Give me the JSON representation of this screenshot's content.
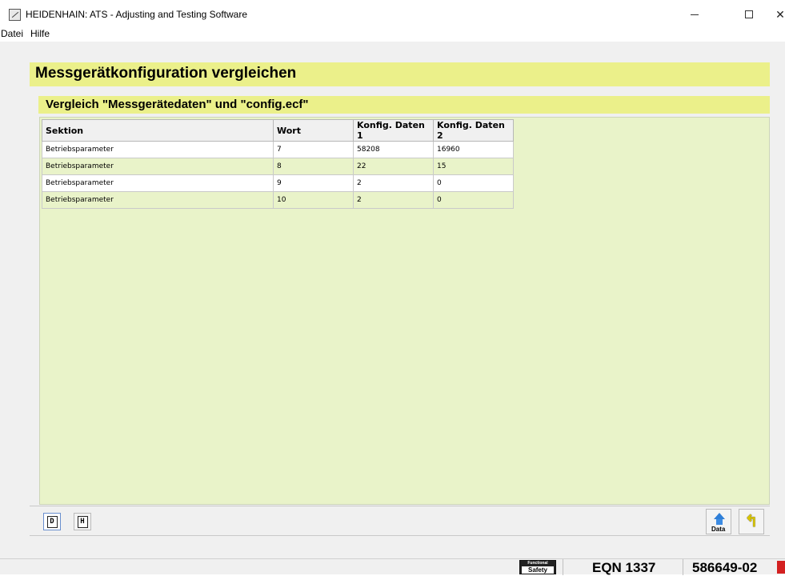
{
  "window": {
    "title": "HEIDENHAIN: ATS - Adjusting and Testing Software"
  },
  "menu": {
    "items": [
      "Datei",
      "Hilfe"
    ]
  },
  "page": {
    "title": "Messgerätkonfiguration vergleichen",
    "subtitle": "Vergleich \"Messgerätedaten\" und \"config.ecf\""
  },
  "table": {
    "columns": [
      "Sektion",
      "Wort",
      "Konfig. Daten 1",
      "Konfig. Daten 2"
    ],
    "rows": [
      [
        "Betriebsparameter",
        "7",
        "58208",
        "16960"
      ],
      [
        "Betriebsparameter",
        "8",
        "22",
        "15"
      ],
      [
        "Betriebsparameter",
        "9",
        "2",
        "0"
      ],
      [
        "Betriebsparameter",
        "10",
        "2",
        "0"
      ]
    ]
  },
  "toolbar": {
    "d_label": "D",
    "h_label": "H",
    "data_label": "Data"
  },
  "status": {
    "safety_line1": "Functional",
    "safety_line2": "Safety",
    "device": "EQN 1337",
    "id": "586649-02"
  },
  "icons": {
    "app": "heidenhain-app-icon",
    "minimize": "minimize-icon",
    "maximize": "maximize-icon",
    "close": "close-icon",
    "data_upload": "upload-arrow-icon",
    "back": "back-arrow-icon",
    "status_led": "status-led-icon"
  },
  "colors": {
    "header_band": "#ebf08a",
    "content_bg": "#e9f3c9",
    "status_led": "#d32020",
    "upload_arrow": "#2f7fd8"
  }
}
